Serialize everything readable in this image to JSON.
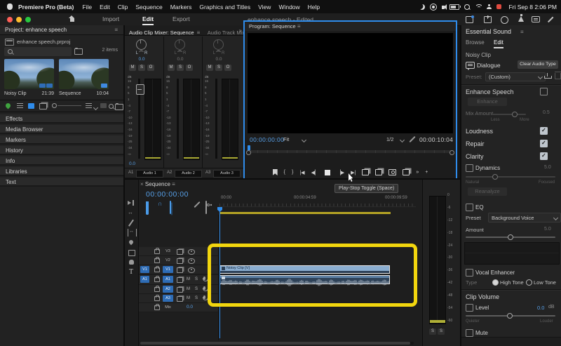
{
  "colors": {
    "accent_blue": "#2f8ceb",
    "timecode_blue": "#57a0e8",
    "annotation_yellow": "#f2d60e",
    "track_blue": "#2e6cb5",
    "workbar_yellow": "#b5a424"
  },
  "menubar": {
    "app_name": "Premiere Pro (Beta)",
    "items": [
      "File",
      "Edit",
      "Clip",
      "Sequence",
      "Markers",
      "Graphics and Titles",
      "View",
      "Window",
      "Help"
    ],
    "clock": "Fri Sep 8  2:06 PM"
  },
  "titlebar": {
    "tabs": {
      "import": "Import",
      "edit": "Edit",
      "export": "Export"
    },
    "doc_title": "enhance speech - Edited"
  },
  "project": {
    "title": "Project: enhance speech",
    "breadcrumb": "enhance speech.prproj",
    "count": "2 items",
    "clips": [
      {
        "name": "Noisy Clip",
        "duration": "21:39"
      },
      {
        "name": "Sequence",
        "duration": "10:04"
      }
    ],
    "panel_tabs": [
      "Effects",
      "Media Browser",
      "Markers",
      "History",
      "Info",
      "Libraries",
      "Text"
    ]
  },
  "mixer": {
    "tab_active": "Audio Clip Mixer: Sequence",
    "tab_inactive": "Audio Track Mixer: Seque",
    "overflow": "»",
    "pan_left": "L",
    "pan_right": "R",
    "db_label": "dB",
    "db_ticks": [
      "15",
      "9",
      "5",
      "1",
      "-4",
      "-7",
      "-10",
      "-13",
      "-16",
      "-19",
      "-25",
      "-34",
      "-∞"
    ],
    "channels": [
      {
        "value": "0.0",
        "mute": "M",
        "solo": "S",
        "o": "O",
        "track": "A1",
        "name": "Audio 1"
      },
      {
        "value": "0.0",
        "mute": "M",
        "solo": "S",
        "o": "O",
        "track": "A2",
        "name": "Audio 2"
      },
      {
        "value": "0.0",
        "mute": "M",
        "solo": "S",
        "o": "O",
        "track": "A3",
        "name": "Audio 3"
      }
    ],
    "bottom_value": "0.0"
  },
  "program": {
    "title": "Program: Sequence",
    "timecode": "00:00:00:00",
    "zoom_level": "Fit",
    "playback_res": "1/2",
    "duration": "00:00:10:04",
    "mark_in": "{",
    "mark_out": "}",
    "goto_in": "|◀",
    "step_back": "◀▏",
    "step_fwd": "▕▶",
    "goto_out": "▶|",
    "overflow": "»",
    "add": "+",
    "tooltip": "Play-Stop Toggle (Space)"
  },
  "timeline": {
    "close": "×",
    "tab": "Sequence",
    "timecode": "00:00:00:00",
    "ruler": [
      "00:00",
      "00:00:04:59",
      "00:00:09:59"
    ],
    "labels": {
      "mute": "M",
      "solo": "S"
    },
    "video_tracks": [
      {
        "name": "V3",
        "patch": ""
      },
      {
        "name": "V2",
        "patch": ""
      },
      {
        "name": "V1",
        "patch": "V1"
      }
    ],
    "audio_tracks": [
      {
        "name": "A1",
        "patch": "A1"
      },
      {
        "name": "A2",
        "patch": ""
      },
      {
        "name": "A3",
        "patch": ""
      }
    ],
    "mix_track": {
      "name": "Mix",
      "value": "0.0"
    },
    "video_clip_label": "Noisy Clip [V]",
    "meter_ticks": [
      "0",
      "-6",
      "-12",
      "-18",
      "-24",
      "-30",
      "-36",
      "-42",
      "-48",
      "-54",
      "-60"
    ],
    "solo_left": "S",
    "solo_right": "S"
  },
  "essential_sound": {
    "title": "Essential Sound",
    "tabs": {
      "browse": "Browse",
      "edit": "Edit"
    },
    "clip_name": "Noisy Clip",
    "audio_type": "Dialogue",
    "clear_button": "Clear Audio Type",
    "preset_label": "Preset:",
    "preset_value": "(Custom)",
    "enhance_speech": {
      "label": "Enhance Speech",
      "button": "Enhance",
      "mix_label": "Mix Amount",
      "mix_min": "Less",
      "mix_max": "More",
      "mix_value": "0.5"
    },
    "loudness_label": "Loudness",
    "repair_label": "Repair",
    "clarity_label": "Clarity",
    "dynamics": {
      "label": "Dynamics",
      "value": "5.0",
      "min": "Natural",
      "max": "Focused",
      "button": "Reanalyze"
    },
    "eq": {
      "label": "EQ",
      "preset_label": "Preset",
      "preset_value": "Background Voice",
      "amount_label": "Amount",
      "amount_value": "5.0"
    },
    "vocal": {
      "label": "Vocal Enhancer",
      "type_label": "Type",
      "option_high": "High Tone",
      "option_low": "Low Tone"
    },
    "clip_volume": {
      "header": "Clip Volume",
      "level_label": "Level",
      "level_value": "0.0",
      "level_unit": "dB",
      "min": "Quieter",
      "max": "Louder",
      "mute_label": "Mute"
    }
  }
}
